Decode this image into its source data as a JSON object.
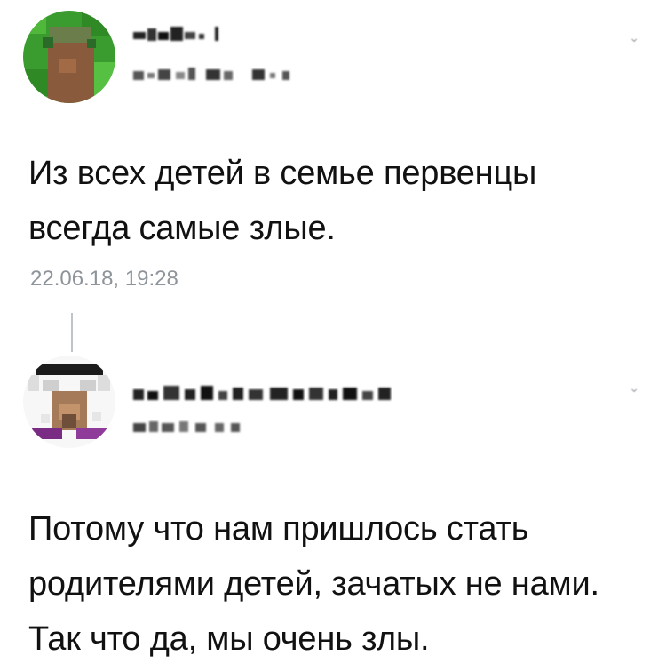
{
  "posts": [
    {
      "author_name": "",
      "meta_text": "",
      "text": "Из всех детей в семье первенцы всегда самые злые.",
      "timestamp": "22.06.18, 19:28"
    },
    {
      "author_name": "",
      "meta_text": "",
      "text": "Потому что нам пришлось стать родителями детей, зачатых не нами. Так что да, мы очень злы."
    }
  ],
  "colors": {
    "text": "#111111",
    "timestamp": "#8e9499",
    "thread_line": "#bfc4c9",
    "avatar1_green": "#3a9b2e",
    "avatar1_brown": "#8a5a3c",
    "avatar2_deer": "#a57a58",
    "avatar2_purple": "#7a2b84"
  },
  "icons": {
    "menu": "chevron-down-icon",
    "avatar1": "avatar-pixelated-icon",
    "avatar2": "avatar-pixelated-icon"
  }
}
